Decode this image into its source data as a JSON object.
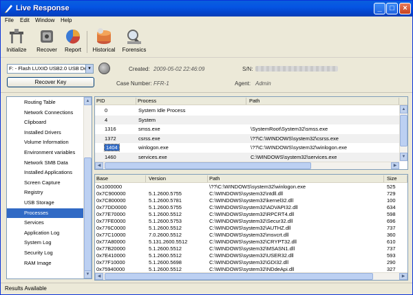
{
  "window": {
    "title": "Live Response",
    "status": "Results Available"
  },
  "menu": [
    "File",
    "Edit",
    "Window",
    "Help"
  ],
  "toolbar": [
    {
      "label": "Initialize",
      "icon": "initialize-icon"
    },
    {
      "label": "Recover",
      "icon": "recover-icon"
    },
    {
      "label": "Report",
      "icon": "report-icon"
    },
    {
      "label": "Historical",
      "icon": "historical-icon"
    },
    {
      "label": "Forensics",
      "icon": "forensics-icon"
    }
  ],
  "info": {
    "drive_select": "F: - Flash LUXIO USB2.0 USB Device",
    "recover_key_label": "Recover Key",
    "created_label": "Created:",
    "created_value": "2009-05-02 22:46:09",
    "sn_label": "S/N:",
    "case_label": "Case Number:",
    "case_value": "FFR-1",
    "agent_label": "Agent:",
    "agent_value": "Admin"
  },
  "sidebar": {
    "selected": "Processes",
    "items": [
      "Routing Table",
      "Network Connections",
      "Clipboard",
      "Installed Drivers",
      "Volume Information",
      "Environment variables",
      "Network SMB Data",
      "Installed Applications",
      "Screen Capture",
      "Registry",
      "USB Storage",
      "Processes",
      "Services",
      "Application Log",
      "System Log",
      "Security Log",
      "RAM Image"
    ]
  },
  "processes": {
    "columns": [
      "PID",
      "Process",
      "Path"
    ],
    "rows": [
      {
        "pid": "0",
        "process": "System Idle Process",
        "path": ""
      },
      {
        "pid": "4",
        "process": "System",
        "path": ""
      },
      {
        "pid": "1316",
        "process": "smss.exe",
        "path": "\\SystemRoot\\System32\\smss.exe"
      },
      {
        "pid": "1372",
        "process": "csrss.exe",
        "path": "\\??\\C:\\WINDOWS\\system32\\csrss.exe"
      },
      {
        "pid": "1404",
        "process": "winlogon.exe",
        "path": "\\??\\C:\\WINDOWS\\system32\\winlogon.exe"
      },
      {
        "pid": "1460",
        "process": "services.exe",
        "path": "C:\\WINDOWS\\system32\\services.exe"
      }
    ],
    "selected_pid": "1404"
  },
  "modules": {
    "columns": [
      "Base",
      "Version",
      "Path",
      "Size"
    ],
    "rows": [
      {
        "base": "0x1000000",
        "version": "",
        "path": "\\??\\C:\\WINDOWS\\system32\\winlogon.exe",
        "size": "525"
      },
      {
        "base": "0x7C900000",
        "version": "5.1.2600.5755",
        "path": "C:\\WINDOWS\\system32\\ntdll.dll",
        "size": "729"
      },
      {
        "base": "0x7C800000",
        "version": "5.1.2600.5781",
        "path": "C:\\WINDOWS\\system32\\kernel32.dll",
        "size": "100"
      },
      {
        "base": "0x77DD0000",
        "version": "5.1.2600.5755",
        "path": "C:\\WINDOWS\\system32\\ADVAPI32.dll",
        "size": "634"
      },
      {
        "base": "0x77E70000",
        "version": "5.1.2600.5512",
        "path": "C:\\WINDOWS\\system32\\RPCRT4.dll",
        "size": "598"
      },
      {
        "base": "0x77FE0000",
        "version": "5.1.2600.5753",
        "path": "C:\\WINDOWS\\system32\\Secur32.dll",
        "size": "696"
      },
      {
        "base": "0x776C0000",
        "version": "5.1.2600.5512",
        "path": "C:\\WINDOWS\\system32\\AUTHZ.dll",
        "size": "737"
      },
      {
        "base": "0x77C10000",
        "version": "7.0.2600.5512",
        "path": "C:\\WINDOWS\\system32\\msvcrt.dll",
        "size": "360"
      },
      {
        "base": "0x77A80000",
        "version": "5.131.2600.5512",
        "path": "C:\\WINDOWS\\system32\\CRYPT32.dll",
        "size": "610"
      },
      {
        "base": "0x77B20000",
        "version": "5.1.2600.5512",
        "path": "C:\\WINDOWS\\system32\\MSASN1.dll",
        "size": "737"
      },
      {
        "base": "0x7E410000",
        "version": "5.1.2600.5512",
        "path": "C:\\WINDOWS\\system32\\USER32.dll",
        "size": "593"
      },
      {
        "base": "0x77F10000",
        "version": "5.1.2600.5698",
        "path": "C:\\WINDOWS\\system32\\GDI32.dll",
        "size": "290"
      },
      {
        "base": "0x75940000",
        "version": "5.1.2600.5512",
        "path": "C:\\WINDOWS\\system32\\NDdeApi.dll",
        "size": "327"
      }
    ]
  },
  "colors": {
    "titlebar": "#0554e3",
    "selection": "#316ac5",
    "chrome": "#ece9d8"
  }
}
